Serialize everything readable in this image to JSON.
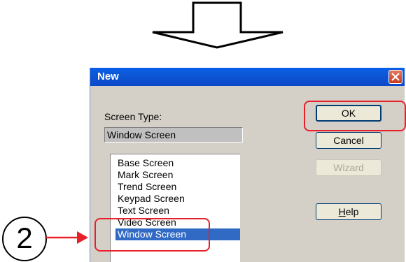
{
  "dialog": {
    "title": "New",
    "screen_type_label": "Screen Type:",
    "screen_type_value": "Window Screen",
    "list_items": [
      "Base Screen",
      "Mark Screen",
      "Trend Screen",
      "Keypad Screen",
      "Text Screen",
      "Video Screen",
      "Window Screen"
    ],
    "selected_item": "Window Screen",
    "buttons": {
      "ok": "OK",
      "cancel": "Cancel",
      "wizard": "Wizard",
      "help_prefix": "",
      "help_mnemonic": "H",
      "help_rest": "elp"
    }
  },
  "annotation": {
    "step_number": "2",
    "highlight_color": "#e8202a"
  },
  "colors": {
    "titlebar": "#0b55d8",
    "selection": "#316ac5",
    "dialog_face": "#d4d0c8"
  }
}
